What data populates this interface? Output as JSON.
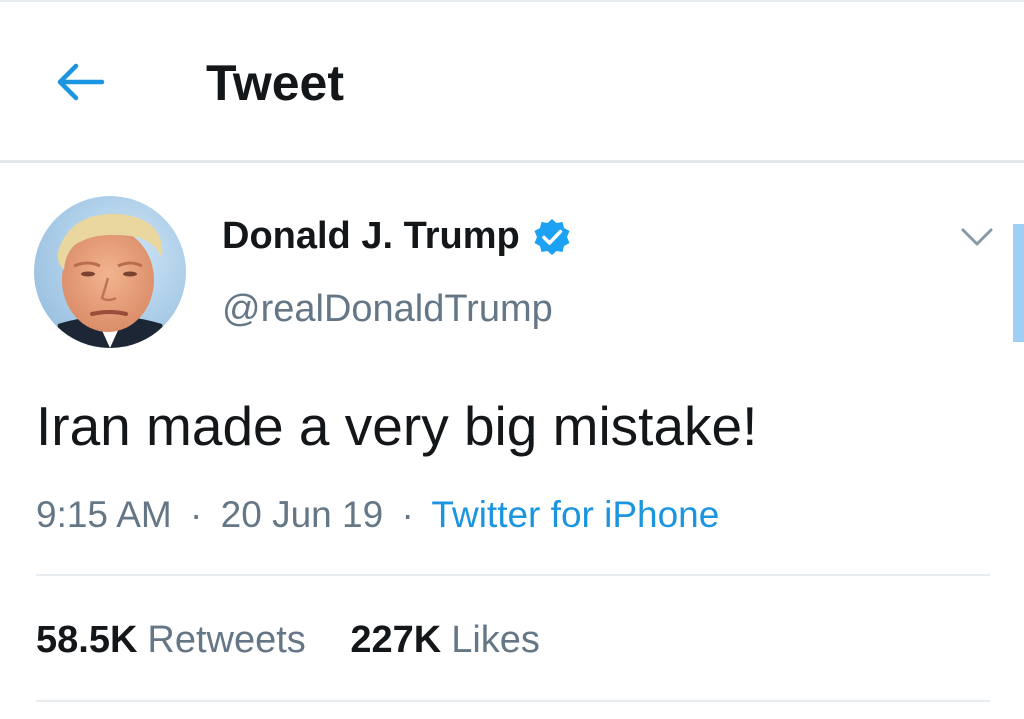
{
  "header": {
    "title": "Tweet",
    "back_icon": "arrow-left-icon"
  },
  "tweet": {
    "author": {
      "name": "Donald J. Trump",
      "handle": "@realDonaldTrump",
      "verified": true
    },
    "text": "Iran made a very big mistake!",
    "time": "9:15 AM",
    "date": "20 Jun 19",
    "separator": "·",
    "source": "Twitter for iPhone"
  },
  "stats": {
    "retweets_count": "58.5K",
    "retweets_label": "Retweets",
    "likes_count": "227K",
    "likes_label": "Likes"
  },
  "colors": {
    "accent": "#1b95e0",
    "text_primary": "#14171a",
    "text_secondary": "#657786",
    "divider": "#e6ecf0"
  }
}
